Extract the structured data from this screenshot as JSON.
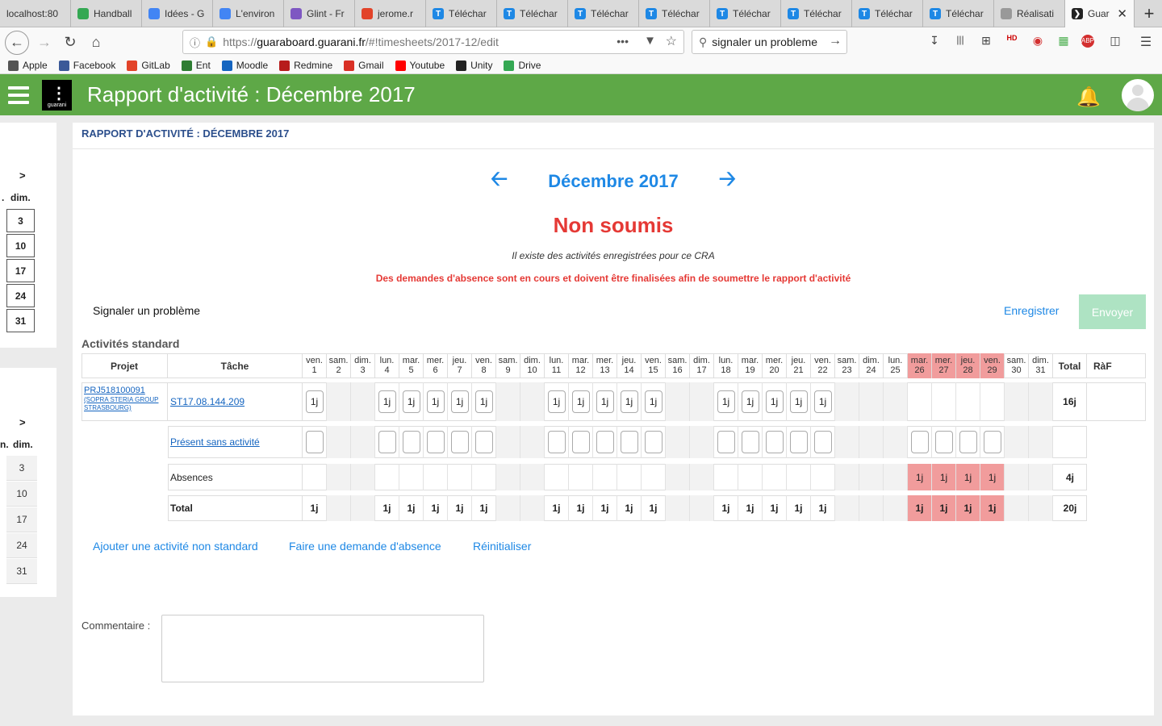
{
  "browser": {
    "tabs": [
      {
        "label": "localhost:80",
        "icon": "none",
        "color": ""
      },
      {
        "label": "Handball",
        "icon": "drive-icon",
        "color": "#34a853"
      },
      {
        "label": "Idées - G",
        "icon": "docs-icon",
        "color": "#4285f4"
      },
      {
        "label": "L'environ",
        "icon": "docs-icon",
        "color": "#4285f4"
      },
      {
        "label": "Glint - Fr",
        "icon": "glint-icon",
        "color": "#7e57c2"
      },
      {
        "label": "jerome.r",
        "icon": "gitlab-icon",
        "color": "#e24329"
      },
      {
        "label": "Téléchar",
        "icon": "t-icon",
        "color": "#1e88e5"
      },
      {
        "label": "Téléchar",
        "icon": "t-icon",
        "color": "#1e88e5"
      },
      {
        "label": "Téléchar",
        "icon": "t-icon",
        "color": "#1e88e5"
      },
      {
        "label": "Téléchar",
        "icon": "t-icon",
        "color": "#1e88e5"
      },
      {
        "label": "Téléchar",
        "icon": "t-icon",
        "color": "#1e88e5"
      },
      {
        "label": "Téléchar",
        "icon": "t-icon",
        "color": "#1e88e5"
      },
      {
        "label": "Téléchar",
        "icon": "t-icon",
        "color": "#1e88e5"
      },
      {
        "label": "Téléchar",
        "icon": "t-icon",
        "color": "#1e88e5"
      },
      {
        "label": "Réalisati",
        "icon": "apple-icon",
        "color": "#999999"
      }
    ],
    "active_tab": "Guar",
    "url": "https://guaraboard.guarani.fr/#!timesheets/2017-12/edit",
    "url_host": "guaraboard.guarani.fr",
    "url_prefix": "https://",
    "url_path": "/#!timesheets/2017-12/edit",
    "search_value": "signaler un probleme",
    "bookmarks": [
      {
        "label": "Apple",
        "color": "#555555"
      },
      {
        "label": "Facebook",
        "color": "#3b5998"
      },
      {
        "label": "GitLab",
        "color": "#e24329"
      },
      {
        "label": "Ent",
        "color": "#2e7d32"
      },
      {
        "label": "Moodle",
        "color": "#1565c0"
      },
      {
        "label": "Redmine",
        "color": "#b71c1c"
      },
      {
        "label": "Gmail",
        "color": "#d93025"
      },
      {
        "label": "Youtube",
        "color": "#ff0000"
      },
      {
        "label": "Unity",
        "color": "#222222"
      },
      {
        "label": "Drive",
        "color": "#34a853"
      }
    ]
  },
  "app": {
    "title": "Rapport d'activité : Décembre 2017",
    "logo_text": "guarani",
    "accent": "#5ea847"
  },
  "left_calendar": {
    "arrow": ">",
    "day_header": "dim.",
    "prev_header": ".",
    "prev_header2": "n.",
    "days_top": [
      "3",
      "10",
      "17",
      "24",
      "31"
    ],
    "days_bottom": [
      "3",
      "10",
      "17",
      "24",
      "31"
    ]
  },
  "page": {
    "heading": "RAPPORT D'ACTIVITÉ : DÉCEMBRE 2017",
    "month_label": "Décembre 2017",
    "status": "Non soumis",
    "info": "Il existe des activités enregistrées pour ce CRA",
    "warning": "Des demandes d'absence sont en cours et doivent être finalisées afin de soumettre le rapport d'activité",
    "signal_link": "Signaler un problème",
    "save_label": "Enregistrer",
    "send_label": "Envoyer",
    "section_title": "Activités standard",
    "col_project": "Projet",
    "col_task": "Tâche",
    "col_total": "Total",
    "col_raf": "RàF",
    "project_code": "PRJ518100091",
    "project_client_1": "(SOPRA STERIA GROUP",
    "project_client_2": "STRASBOURG)",
    "task_code": "ST17.08.144.209",
    "row2_label": "Présent sans activité",
    "row3_label": "Absences",
    "row4_label": "Total",
    "row1_total": "16j",
    "row3_total": "4j",
    "row4_total": "20j",
    "add_activity": "Ajouter une activité non standard",
    "absence_request": "Faire une demande d'absence",
    "reset": "Réinitialiser",
    "comment_label": "Commentaire :"
  },
  "calendar": {
    "days": [
      {
        "wd": "ven.",
        "d": "1",
        "type": "work",
        "act": "1j",
        "abs": "",
        "tot": "1j"
      },
      {
        "wd": "sam.",
        "d": "2",
        "type": "we",
        "act": "",
        "abs": "",
        "tot": ""
      },
      {
        "wd": "dim.",
        "d": "3",
        "type": "we",
        "act": "",
        "abs": "",
        "tot": ""
      },
      {
        "wd": "lun.",
        "d": "4",
        "type": "work",
        "act": "1j",
        "abs": "",
        "tot": "1j"
      },
      {
        "wd": "mar.",
        "d": "5",
        "type": "work",
        "act": "1j",
        "abs": "",
        "tot": "1j"
      },
      {
        "wd": "mer.",
        "d": "6",
        "type": "work",
        "act": "1j",
        "abs": "",
        "tot": "1j"
      },
      {
        "wd": "jeu.",
        "d": "7",
        "type": "work",
        "act": "1j",
        "abs": "",
        "tot": "1j"
      },
      {
        "wd": "ven.",
        "d": "8",
        "type": "work",
        "act": "1j",
        "abs": "",
        "tot": "1j"
      },
      {
        "wd": "sam.",
        "d": "9",
        "type": "we",
        "act": "",
        "abs": "",
        "tot": ""
      },
      {
        "wd": "dim.",
        "d": "10",
        "type": "we",
        "act": "",
        "abs": "",
        "tot": ""
      },
      {
        "wd": "lun.",
        "d": "11",
        "type": "work",
        "act": "1j",
        "abs": "",
        "tot": "1j"
      },
      {
        "wd": "mar.",
        "d": "12",
        "type": "work",
        "act": "1j",
        "abs": "",
        "tot": "1j"
      },
      {
        "wd": "mer.",
        "d": "13",
        "type": "work",
        "act": "1j",
        "abs": "",
        "tot": "1j"
      },
      {
        "wd": "jeu.",
        "d": "14",
        "type": "work",
        "act": "1j",
        "abs": "",
        "tot": "1j"
      },
      {
        "wd": "ven.",
        "d": "15",
        "type": "work",
        "act": "1j",
        "abs": "",
        "tot": "1j"
      },
      {
        "wd": "sam.",
        "d": "16",
        "type": "we",
        "act": "",
        "abs": "",
        "tot": ""
      },
      {
        "wd": "dim.",
        "d": "17",
        "type": "we",
        "act": "",
        "abs": "",
        "tot": ""
      },
      {
        "wd": "lun.",
        "d": "18",
        "type": "work",
        "act": "1j",
        "abs": "",
        "tot": "1j"
      },
      {
        "wd": "mar.",
        "d": "19",
        "type": "work",
        "act": "1j",
        "abs": "",
        "tot": "1j"
      },
      {
        "wd": "mer.",
        "d": "20",
        "type": "work",
        "act": "1j",
        "abs": "",
        "tot": "1j"
      },
      {
        "wd": "jeu.",
        "d": "21",
        "type": "work",
        "act": "1j",
        "abs": "",
        "tot": "1j"
      },
      {
        "wd": "ven.",
        "d": "22",
        "type": "work",
        "act": "1j",
        "abs": "",
        "tot": "1j"
      },
      {
        "wd": "sam.",
        "d": "23",
        "type": "we",
        "act": "",
        "abs": "",
        "tot": ""
      },
      {
        "wd": "dim.",
        "d": "24",
        "type": "we",
        "act": "",
        "abs": "",
        "tot": ""
      },
      {
        "wd": "lun.",
        "d": "25",
        "type": "holiday",
        "act": "",
        "abs": "",
        "tot": ""
      },
      {
        "wd": "mar.",
        "d": "26",
        "type": "absence",
        "act": "",
        "abs": "1j",
        "tot": "1j"
      },
      {
        "wd": "mer.",
        "d": "27",
        "type": "absence",
        "act": "",
        "abs": "1j",
        "tot": "1j"
      },
      {
        "wd": "jeu.",
        "d": "28",
        "type": "absence",
        "act": "",
        "abs": "1j",
        "tot": "1j"
      },
      {
        "wd": "ven.",
        "d": "29",
        "type": "absence",
        "act": "",
        "abs": "1j",
        "tot": "1j"
      },
      {
        "wd": "sam.",
        "d": "30",
        "type": "we",
        "act": "",
        "abs": "",
        "tot": ""
      },
      {
        "wd": "dim.",
        "d": "31",
        "type": "we",
        "act": "",
        "abs": "",
        "tot": ""
      }
    ],
    "colors": {
      "weekend": "#f2f2f2",
      "absence": "#f19c9c",
      "link": "#1e88e5",
      "status": "#e53935"
    }
  }
}
